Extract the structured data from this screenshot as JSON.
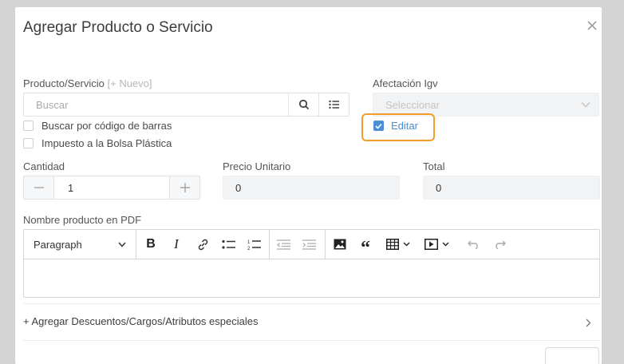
{
  "modal": {
    "title": "Agregar Producto o Servicio"
  },
  "producto": {
    "label": "Producto/Servicio",
    "nuevo_link": "[+ Nuevo]",
    "search_placeholder": "Buscar"
  },
  "afectacion": {
    "label": "Afectación Igv",
    "placeholder": "Seleccionar"
  },
  "checkboxes": {
    "barcode": {
      "label": "Buscar por código de barras",
      "checked": false
    },
    "bolsa": {
      "label": "Impuesto a la Bolsa Plástica",
      "checked": false
    },
    "editar": {
      "label": "Editar",
      "checked": true
    }
  },
  "cantidad": {
    "label": "Cantidad",
    "value": "1"
  },
  "precio": {
    "label": "Precio Unitario",
    "value": "0"
  },
  "total": {
    "label": "Total",
    "value": "0"
  },
  "editor": {
    "label": "Nombre producto en PDF",
    "paragraph": "Paragraph",
    "content": ""
  },
  "accordion": {
    "label": "+ Agregar Descuentos/Cargos/Atributos especiales"
  },
  "colors": {
    "accent": "#4a8fd6",
    "highlight": "#f39c2a",
    "overlay": "#d4d4d4"
  },
  "icons": [
    "close-icon",
    "search-icon",
    "list-icon",
    "chevron-down-icon",
    "check-icon",
    "minus-icon",
    "plus-icon",
    "bold-icon",
    "italic-icon",
    "link-icon",
    "bulleted-list-icon",
    "numbered-list-icon",
    "outdent-icon",
    "indent-icon",
    "image-icon",
    "blockquote-icon",
    "table-icon",
    "media-icon",
    "undo-icon",
    "redo-icon",
    "chevron-right-icon"
  ]
}
